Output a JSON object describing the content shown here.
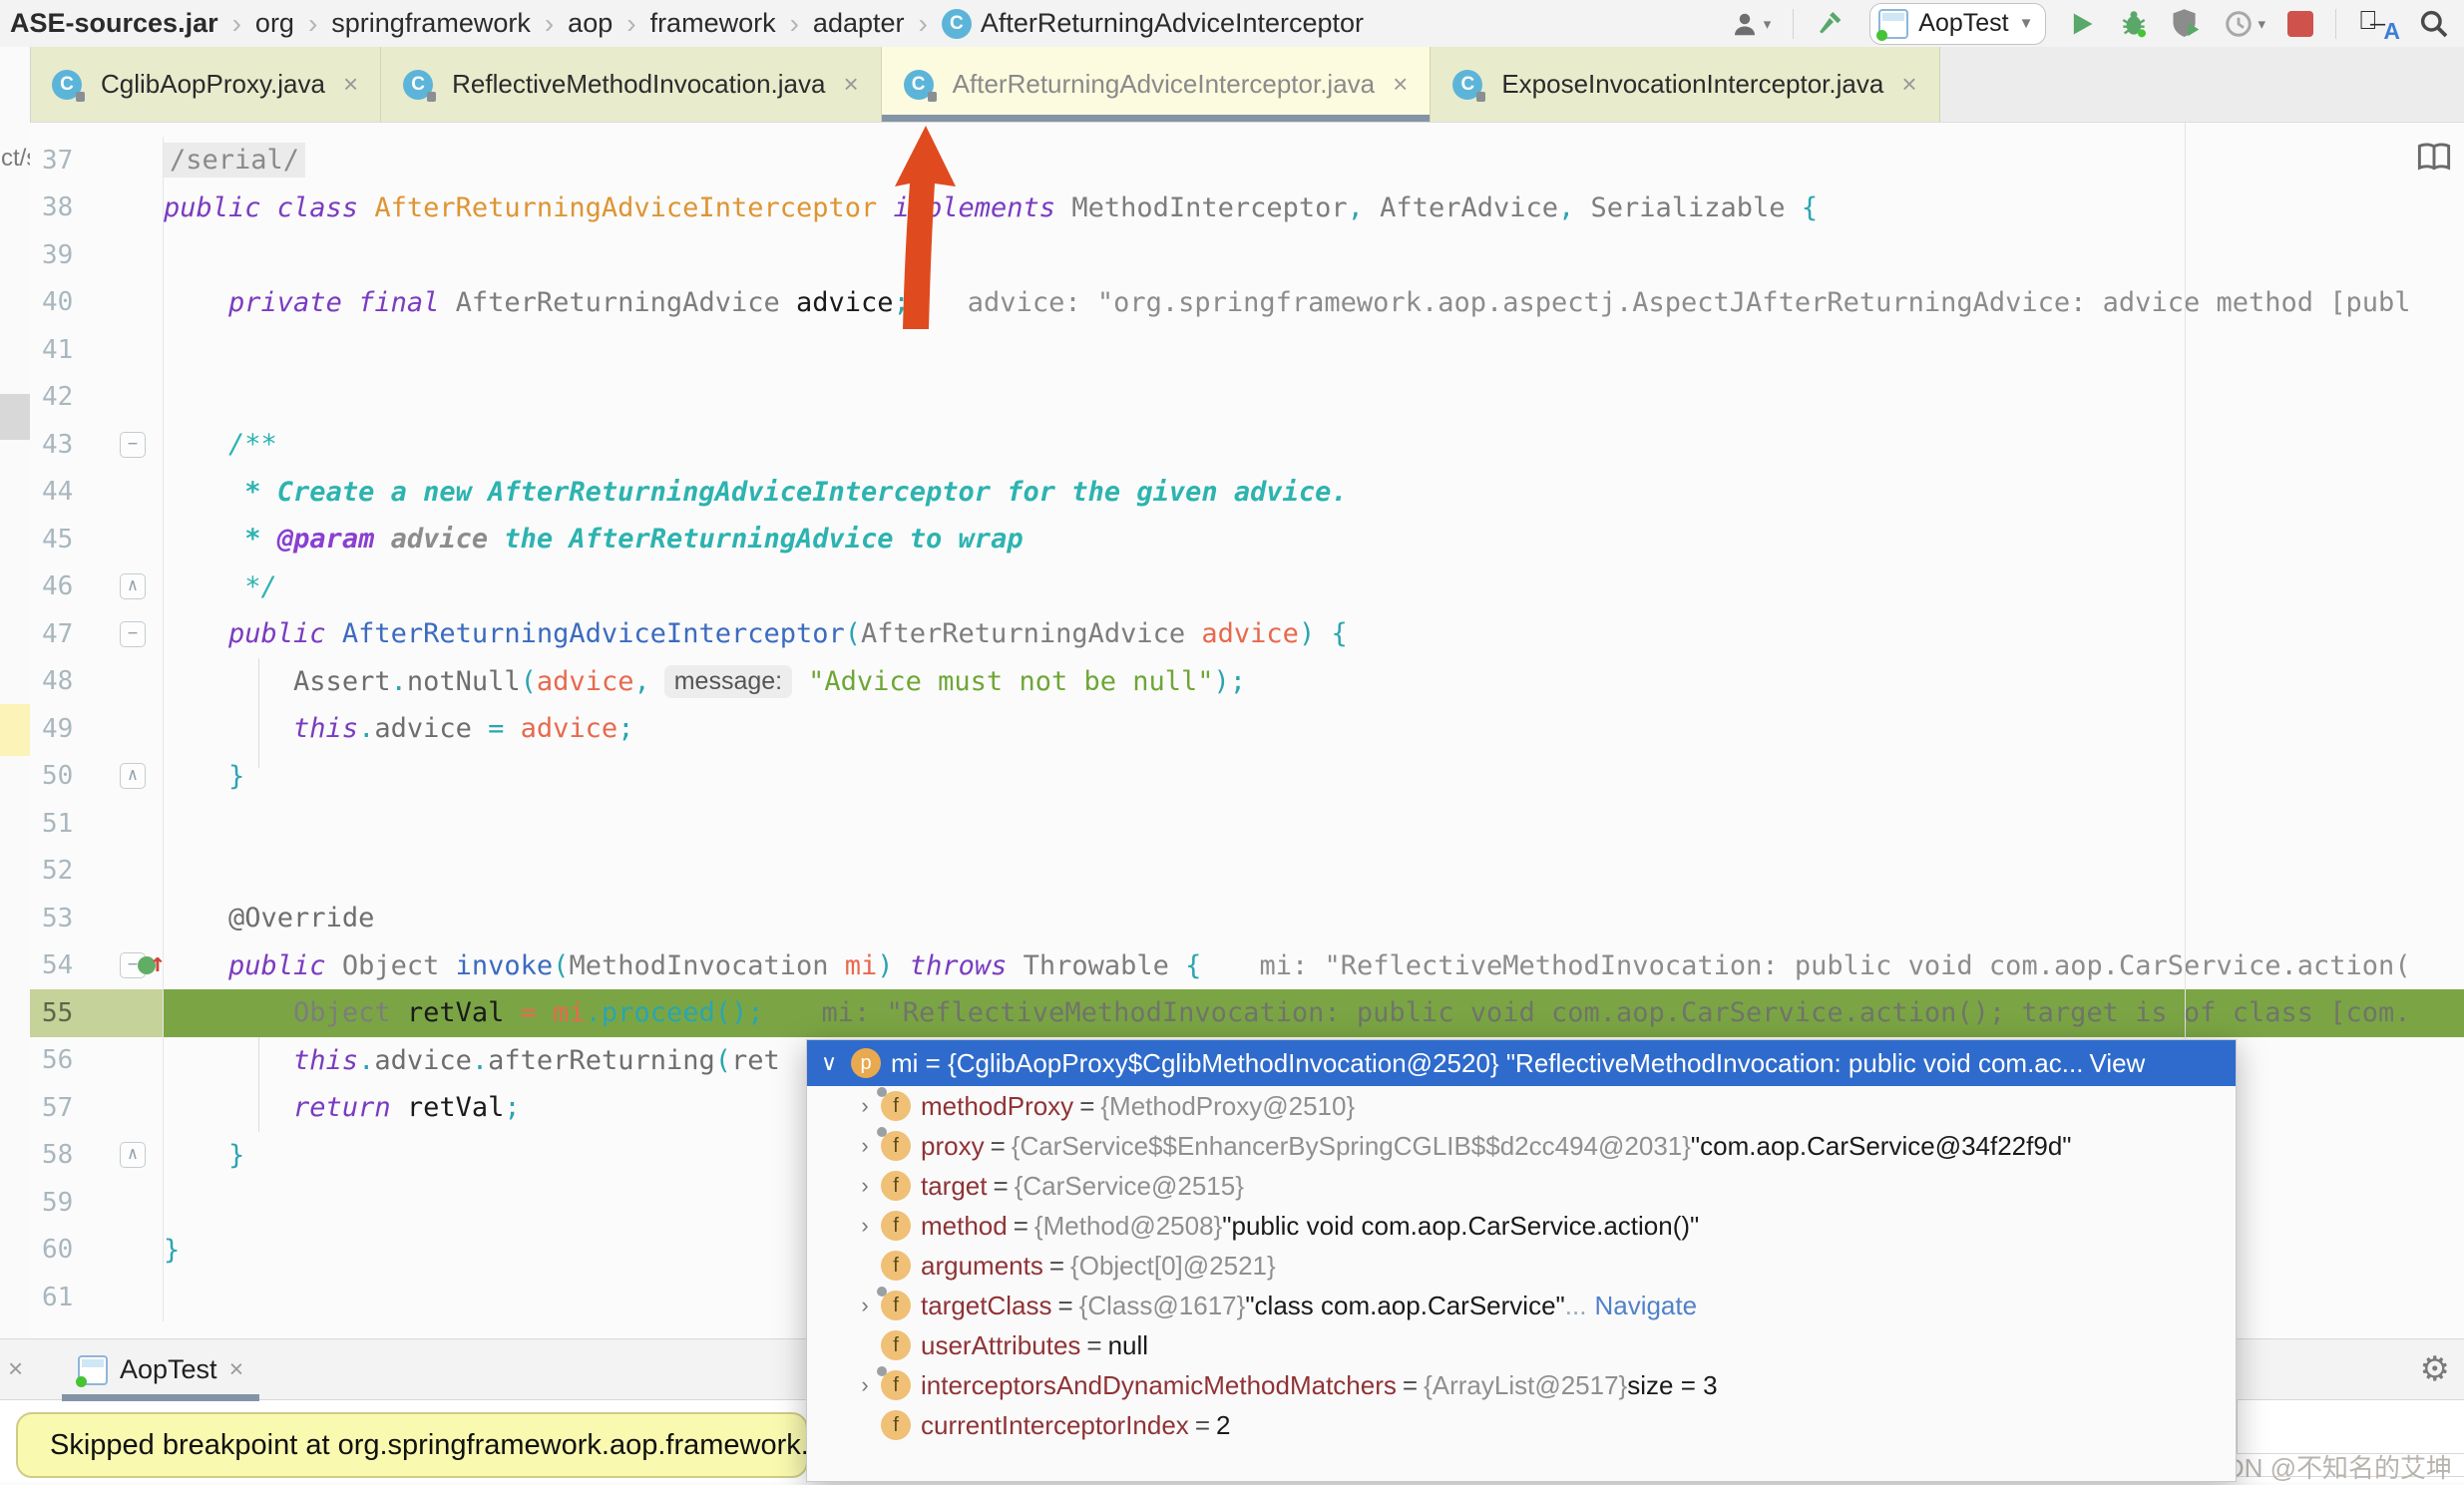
{
  "breadcrumb": {
    "items": [
      "ASE-sources.jar",
      "org",
      "springframework",
      "aop",
      "framework",
      "adapter",
      "AfterReturningAdviceInterceptor"
    ],
    "class_icon_letter": "C"
  },
  "toolbar": {
    "run_config_label": "AopTest",
    "icons": [
      "user-menu",
      "build-hammer",
      "run-config-combo",
      "run-play",
      "debug-bug",
      "run-with-coverage",
      "profiler",
      "stop",
      "translate",
      "search"
    ]
  },
  "tabs": {
    "items": [
      {
        "label": "CglibAopProxy.java",
        "selected": false
      },
      {
        "label": "ReflectiveMethodInvocation.java",
        "selected": false
      },
      {
        "label": "AfterReturningAdviceInterceptor.java",
        "selected": true
      },
      {
        "label": "ExposeInvocationInterceptor.java",
        "selected": false
      }
    ],
    "close_glyph": "×",
    "icon_letter": "C"
  },
  "left_strip": {
    "fragment_text": "ct/s"
  },
  "editor": {
    "colors": {
      "exec_line_bg": "#7ba544",
      "selected_tab_underline": "#8394a6",
      "popup_header_bg": "#2e6bcc",
      "arrow_red": "#e04a1f"
    },
    "lines": [
      {
        "num": 37,
        "seg": [
          [
            "fold",
            "/serial/"
          ]
        ]
      },
      {
        "num": 38,
        "seg": [
          [
            "k",
            "public class "
          ],
          [
            "cls",
            "AfterReturningAdviceInterceptor "
          ],
          [
            "k",
            "implements "
          ],
          [
            "ty",
            "MethodInterceptor"
          ],
          [
            "pn",
            ", "
          ],
          [
            "ty",
            "AfterAdvice"
          ],
          [
            "pn",
            ", "
          ],
          [
            "ty",
            "Serializable "
          ],
          [
            "pn",
            "{"
          ]
        ]
      },
      {
        "num": 39,
        "seg": []
      },
      {
        "num": 40,
        "seg": [
          [
            "sp",
            "    "
          ],
          [
            "k",
            "private final "
          ],
          [
            "ty",
            "AfterReturningAdvice "
          ],
          [
            "pl",
            "advice"
          ],
          [
            "pn",
            ";"
          ],
          [
            "hint",
            "advice: \"org.springframework.aop.aspectj.AspectJAfterReturningAdvice: advice method [publ"
          ]
        ]
      },
      {
        "num": 41,
        "seg": []
      },
      {
        "num": 42,
        "seg": []
      },
      {
        "num": 43,
        "mark": "open",
        "seg": [
          [
            "sp",
            "    "
          ],
          [
            "cm",
            "/**"
          ]
        ]
      },
      {
        "num": 44,
        "seg": [
          [
            "sp",
            "    "
          ],
          [
            "cmb",
            " * Create a new AfterReturningAdviceInterceptor for the given advice."
          ]
        ]
      },
      {
        "num": 45,
        "seg": [
          [
            "sp",
            "    "
          ],
          [
            "cmb",
            " * "
          ],
          [
            "tg",
            "@param "
          ],
          [
            "docp",
            "advice "
          ],
          [
            "cmb",
            "the AfterReturningAdvice to wrap"
          ]
        ]
      },
      {
        "num": 46,
        "mark": "end",
        "seg": [
          [
            "sp",
            "    "
          ],
          [
            "cm",
            " */"
          ]
        ]
      },
      {
        "num": 47,
        "mark": "open",
        "seg": [
          [
            "sp",
            "    "
          ],
          [
            "k",
            "public "
          ],
          [
            "mn",
            "AfterReturningAdviceInterceptor"
          ],
          [
            "pn",
            "("
          ],
          [
            "ty",
            "AfterReturningAdvice "
          ],
          [
            "pr",
            "advice"
          ],
          [
            "pn",
            ") {"
          ]
        ]
      },
      {
        "num": 48,
        "seg": [
          [
            "sp",
            "        "
          ],
          [
            "gr",
            "Assert"
          ],
          [
            "pn",
            "."
          ],
          [
            "gr",
            "notNull"
          ],
          [
            "pn",
            "("
          ],
          [
            "pr",
            "advice"
          ],
          [
            "pn",
            ","
          ],
          [
            "chip",
            "message:"
          ],
          [
            "st",
            "\"Advice must not be null\""
          ],
          [
            "pn",
            ");"
          ]
        ]
      },
      {
        "num": 49,
        "seg": [
          [
            "sp",
            "        "
          ],
          [
            "k",
            "this"
          ],
          [
            "pn",
            "."
          ],
          [
            "gr",
            "advice "
          ],
          [
            "pn",
            "= "
          ],
          [
            "pr",
            "advice"
          ],
          [
            "pn",
            ";"
          ]
        ]
      },
      {
        "num": 50,
        "mark": "end",
        "seg": [
          [
            "sp",
            "    "
          ],
          [
            "pn",
            "}"
          ]
        ]
      },
      {
        "num": 51,
        "seg": []
      },
      {
        "num": 52,
        "seg": []
      },
      {
        "num": 53,
        "seg": [
          [
            "sp",
            "    "
          ],
          [
            "gr",
            "@Override"
          ]
        ]
      },
      {
        "num": 54,
        "mark": "open",
        "icon": "exec",
        "seg": [
          [
            "sp",
            "    "
          ],
          [
            "k",
            "public "
          ],
          [
            "ty",
            "Object "
          ],
          [
            "mb",
            "invoke"
          ],
          [
            "pn",
            "("
          ],
          [
            "ty",
            "MethodInvocation "
          ],
          [
            "pr",
            "mi"
          ],
          [
            "pn",
            ") "
          ],
          [
            "k",
            "throws "
          ],
          [
            "ty",
            "Throwable "
          ],
          [
            "pn",
            "{"
          ],
          [
            "hint",
            "mi: \"ReflectiveMethodInvocation: public void com.aop.CarService.action("
          ]
        ]
      },
      {
        "num": 55,
        "hl": true,
        "seg": [
          [
            "sp",
            "        "
          ],
          [
            "ty",
            "Object "
          ],
          [
            "pl",
            "retVal "
          ],
          [
            "pr",
            "= mi"
          ],
          [
            "pn",
            ".proceed();"
          ],
          [
            "hintg",
            "mi: \"ReflectiveMethodInvocation: public void com.aop.CarService.action(); target is of class [com."
          ]
        ]
      },
      {
        "num": 56,
        "seg": [
          [
            "sp",
            "        "
          ],
          [
            "k",
            "this"
          ],
          [
            "pn",
            "."
          ],
          [
            "gr",
            "advice"
          ],
          [
            "pn",
            "."
          ],
          [
            "gr",
            "afterReturning"
          ],
          [
            "pn",
            "("
          ],
          [
            "gr",
            "ret"
          ]
        ]
      },
      {
        "num": 57,
        "seg": [
          [
            "sp",
            "        "
          ],
          [
            "k",
            "return "
          ],
          [
            "pl",
            "retVal"
          ],
          [
            "pn",
            ";"
          ]
        ]
      },
      {
        "num": 58,
        "mark": "end",
        "seg": [
          [
            "sp",
            "    "
          ],
          [
            "pn",
            "}"
          ]
        ]
      },
      {
        "num": 59,
        "seg": []
      },
      {
        "num": 60,
        "seg": [
          [
            "pn",
            "}"
          ]
        ]
      },
      {
        "num": 61,
        "seg": []
      }
    ]
  },
  "debug_popup": {
    "header": {
      "chevron": "∨",
      "icon_letter": "p",
      "text": "mi = {CglibAopProxy$CglibMethodInvocation@2520} \"ReflectiveMethodInvocation: public void com.ac...",
      "view_label": "View"
    },
    "rows": [
      {
        "expand": true,
        "badge": true,
        "name": "methodProxy",
        "eq": "=",
        "gray": "{MethodProxy@2510}",
        "black": ""
      },
      {
        "expand": true,
        "badge": true,
        "name": "proxy",
        "eq": "=",
        "gray": "{CarService$$EnhancerBySpringCGLIB$$d2cc494@2031}",
        "black": " \"com.aop.CarService@34f22f9d\""
      },
      {
        "expand": true,
        "badge": false,
        "name": "target",
        "eq": "=",
        "gray": "{CarService@2515}",
        "black": ""
      },
      {
        "expand": true,
        "badge": false,
        "name": "method",
        "eq": "=",
        "gray": "{Method@2508}",
        "black": " \"public void com.aop.CarService.action()\""
      },
      {
        "expand": false,
        "badge": false,
        "name": "arguments",
        "eq": "=",
        "gray": "{Object[0]@2521}",
        "black": ""
      },
      {
        "expand": true,
        "badge": true,
        "name": "targetClass",
        "eq": "=",
        "gray": "{Class@1617}",
        "black": " \"class com.aop.CarService\"",
        "dots": " ...",
        "link": "Navigate"
      },
      {
        "expand": false,
        "badge": false,
        "name": "userAttributes",
        "eq": "=",
        "gray": "",
        "black": "null"
      },
      {
        "expand": true,
        "badge": true,
        "name": "interceptorsAndDynamicMethodMatchers",
        "eq": "=",
        "gray": "{ArrayList@2517}",
        "black": "  size = 3"
      },
      {
        "expand": false,
        "badge": false,
        "name": "currentInterceptorIndex",
        "eq": "=",
        "gray": "",
        "black": "2"
      }
    ]
  },
  "bottom": {
    "debug_tab_label": "AopTest",
    "debug_tab_close": "×",
    "stray_close": "×",
    "balloon_text": "Skipped breakpoint at org.springframework.aop.framework.Cg",
    "watermark": "CSDN @不知名的艾坤",
    "gear_glyph": "⚙"
  }
}
